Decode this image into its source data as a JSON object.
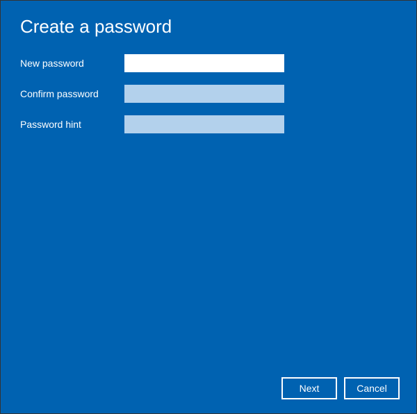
{
  "title": "Create a password",
  "fields": {
    "new_password": {
      "label": "New password",
      "value": ""
    },
    "confirm_password": {
      "label": "Confirm password",
      "value": ""
    },
    "password_hint": {
      "label": "Password hint",
      "value": ""
    }
  },
  "buttons": {
    "next": "Next",
    "cancel": "Cancel"
  },
  "colors": {
    "background": "#0062b1",
    "active_field": "#ffffff",
    "inactive_field": "#b3d1ec",
    "button_border": "#ffffff"
  }
}
